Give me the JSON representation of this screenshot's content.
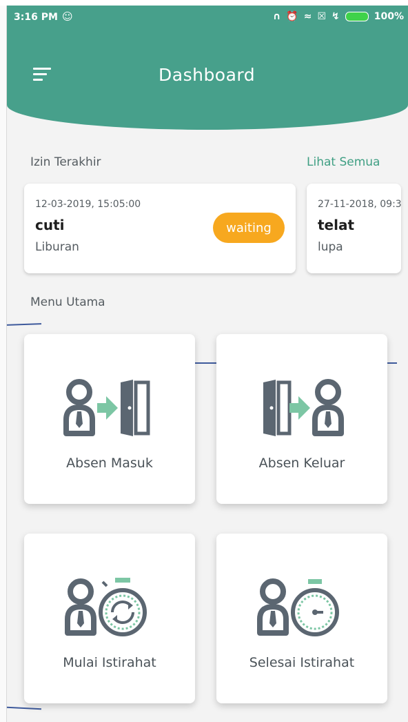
{
  "status_bar": {
    "time": "3:16 PM",
    "battery": "100%"
  },
  "header": {
    "title": "Dashboard"
  },
  "izin": {
    "label": "Izin Terakhir",
    "see_all": "Lihat Semua",
    "items": [
      {
        "date": "12-03-2019, 15:05:00",
        "type": "cuti",
        "reason": "Liburan",
        "status": "waiting"
      },
      {
        "date": "27-11-2018, 09:3",
        "type": "telat",
        "reason": "lupa"
      }
    ]
  },
  "menu": {
    "label": "Menu Utama",
    "items": [
      {
        "label": "Absen Masuk",
        "icon": "person-door-enter-icon"
      },
      {
        "label": "Absen Keluar",
        "icon": "door-person-exit-icon"
      },
      {
        "label": "Mulai Istirahat",
        "icon": "person-stopwatch-start-icon"
      },
      {
        "label": "Selesai Istirahat",
        "icon": "person-stopwatch-finish-icon"
      }
    ]
  },
  "colors": {
    "primary": "#47a08b",
    "accent": "#f7a81f",
    "icon_dark": "#5b6671",
    "icon_light": "#7cc6a4"
  }
}
